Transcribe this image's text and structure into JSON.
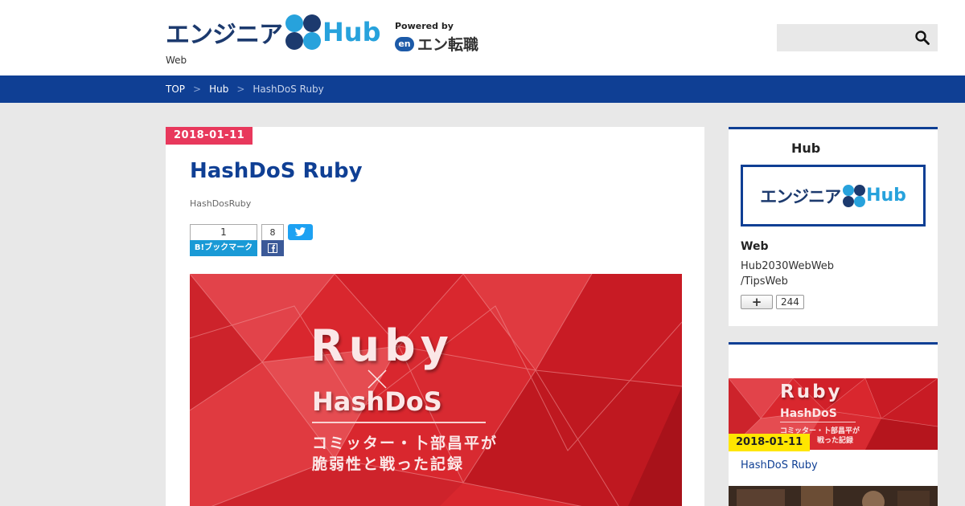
{
  "header": {
    "logo_kana": "エンジニア",
    "logo_hub": "Hub",
    "powered_by": "Powered by",
    "powered_badge": "en",
    "powered_name": "エン転職",
    "tagline": "Web",
    "search_placeholder": ""
  },
  "breadcrumb": {
    "items": [
      "TOP",
      "Hub",
      "HashDoS Ruby"
    ],
    "separator": ">"
  },
  "article": {
    "date": "2018-01-11",
    "title": "HashDoS Ruby",
    "subtitle": "HashDosRuby",
    "share": {
      "hatena_count": "1",
      "hatena_label": "B!ブックマーク",
      "facebook_count": "8"
    },
    "hero": {
      "line1": "Ruby",
      "line2": "HashDoS",
      "line3": "コミッター・卜部昌平が",
      "line4": "脆弱性と戦った記録"
    }
  },
  "sidebar": {
    "box1": {
      "title": "Hub",
      "banner_kana": "エンジニア",
      "banner_hub": "Hub",
      "site_name": "Web",
      "desc_line1": "Hub2030WebWeb",
      "desc_line2": "/TipsWeb",
      "follow_icon": "+",
      "follow_count": "244"
    },
    "box2": {
      "thumb_line1": "Ruby",
      "thumb_line2": "HashDoS",
      "thumb_line3": "コミッター・卜部昌平が",
      "thumb_line4": "戦った記録",
      "date": "2018-01-11",
      "title": "HashDoS Ruby"
    }
  },
  "colors": {
    "brand_navy": "#0f3f94",
    "brand_cyan": "#27a2dc",
    "date_pink": "#e8385c",
    "hero_red": "#d9272e",
    "date_yellow": "#ffe600"
  }
}
